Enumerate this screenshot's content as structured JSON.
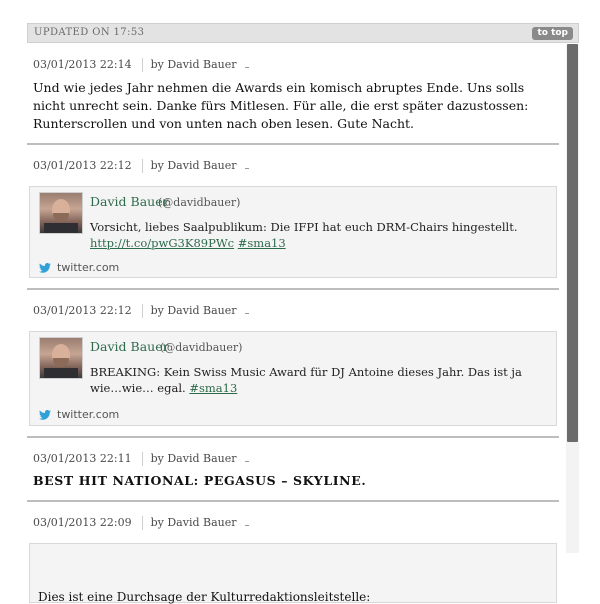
{
  "header": {
    "updated": "UPDATED ON 17:53",
    "to_top": "to top"
  },
  "entries": [
    {
      "date": "03/01/2013 22:14",
      "author": "by David Bauer",
      "text": "Und wie jedes Jahr nehmen die Awards ein komisch abruptes Ende. Uns solls nicht unrecht sein. Danke fürs Mitlesen. Für alle, die erst später dazustossen: Runterscrollen und von unten nach oben lesen. Gute Nacht."
    },
    {
      "date": "03/01/2013 22:12",
      "author": "by David Bauer",
      "tweet": {
        "name": "David Bauer",
        "handle": "(@davidbauer)",
        "text_before": "Vorsicht, liebes Saalpublikum: Die IFPI hat euch DRM-Chairs hingestellt. ",
        "link": "http://t.co/pwG3K89PWc",
        "hashtag": "#sma13",
        "source": "twitter.com"
      }
    },
    {
      "date": "03/01/2013 22:12",
      "author": "by David Bauer",
      "tweet": {
        "name": "David Bauer",
        "handle": "(@davidbauer)",
        "text_before": "BREAKING: Kein Swiss Music Award für DJ Antoine dieses Jahr. Das ist ja wie…wie… egal. ",
        "hashtag": "#sma13",
        "source": "twitter.com"
      }
    },
    {
      "date": "03/01/2013 22:11",
      "author": "by David Bauer",
      "headline": "BEST HIT NATIONAL: PEGASUS – SKYLINE."
    },
    {
      "date": "03/01/2013 22:09",
      "author": "by David Bauer",
      "quote": "Dies ist eine Durchsage der Kulturredaktionsleitstelle:"
    }
  ],
  "colors": {
    "accent_green": "#2e6b4a",
    "bar_gray": "#e3e3e3",
    "scroll_thumb": "#6b6b6b"
  },
  "icons": {
    "source": "twitter-bird-icon"
  }
}
